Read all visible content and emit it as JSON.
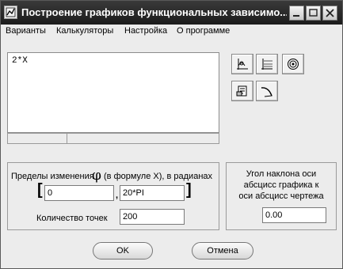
{
  "window": {
    "title": "Построение графиков функциональных зависимо..."
  },
  "menu": {
    "items": [
      "Варианты",
      "Калькуляторы",
      "Настройка",
      "О программе"
    ]
  },
  "editor": {
    "text": "2*X"
  },
  "toolbar": {
    "icons": [
      "plot-axes-icon",
      "plot-grid-icon",
      "polar-plot-icon",
      "print-setup-icon",
      "curve-tool-icon"
    ]
  },
  "range_group": {
    "label_before": "Пределы изменения",
    "phi_symbol": "φ",
    "label_after": "(в формуле X), в радианах",
    "open_bracket": "[",
    "from_value": "0",
    "separator": ",",
    "to_value": "20*PI",
    "close_bracket": "]",
    "points_label": "Количество точек",
    "points_value": "200"
  },
  "angle_group": {
    "line1": "Угол наклона оси",
    "line2": "абсцисс графика к",
    "line3": "оси абсцисс чертежа",
    "value": "0.00"
  },
  "buttons": {
    "ok": "OK",
    "cancel": "Отмена"
  }
}
